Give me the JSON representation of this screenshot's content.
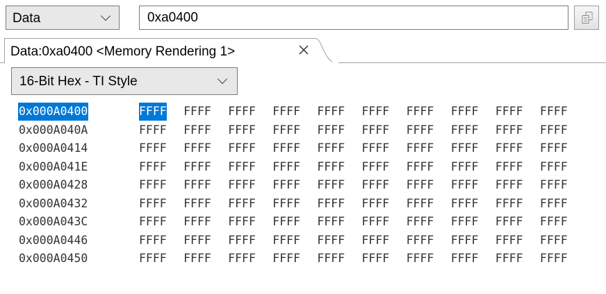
{
  "toolbar": {
    "memory_space": "Data",
    "address": "0xa0400",
    "go_icon": "load-memory-icon"
  },
  "tab": {
    "title": "Data:0xa0400 <Memory Rendering 1>",
    "close_icon": "close-icon"
  },
  "format": {
    "selected": "16-Bit Hex - TI Style"
  },
  "memory": {
    "selected_address_index": 0,
    "selected_word_index": 0,
    "highlight_color": "#0078d7",
    "rows": [
      {
        "address": "0x000A0400",
        "words": [
          "FFFF",
          "FFFF",
          "FFFF",
          "FFFF",
          "FFFF",
          "FFFF",
          "FFFF",
          "FFFF",
          "FFFF",
          "FFFF"
        ]
      },
      {
        "address": "0x000A040A",
        "words": [
          "FFFF",
          "FFFF",
          "FFFF",
          "FFFF",
          "FFFF",
          "FFFF",
          "FFFF",
          "FFFF",
          "FFFF",
          "FFFF"
        ]
      },
      {
        "address": "0x000A0414",
        "words": [
          "FFFF",
          "FFFF",
          "FFFF",
          "FFFF",
          "FFFF",
          "FFFF",
          "FFFF",
          "FFFF",
          "FFFF",
          "FFFF"
        ]
      },
      {
        "address": "0x000A041E",
        "words": [
          "FFFF",
          "FFFF",
          "FFFF",
          "FFFF",
          "FFFF",
          "FFFF",
          "FFFF",
          "FFFF",
          "FFFF",
          "FFFF"
        ]
      },
      {
        "address": "0x000A0428",
        "words": [
          "FFFF",
          "FFFF",
          "FFFF",
          "FFFF",
          "FFFF",
          "FFFF",
          "FFFF",
          "FFFF",
          "FFFF",
          "FFFF"
        ]
      },
      {
        "address": "0x000A0432",
        "words": [
          "FFFF",
          "FFFF",
          "FFFF",
          "FFFF",
          "FFFF",
          "FFFF",
          "FFFF",
          "FFFF",
          "FFFF",
          "FFFF"
        ]
      },
      {
        "address": "0x000A043C",
        "words": [
          "FFFF",
          "FFFF",
          "FFFF",
          "FFFF",
          "FFFF",
          "FFFF",
          "FFFF",
          "FFFF",
          "FFFF",
          "FFFF"
        ]
      },
      {
        "address": "0x000A0446",
        "words": [
          "FFFF",
          "FFFF",
          "FFFF",
          "FFFF",
          "FFFF",
          "FFFF",
          "FFFF",
          "FFFF",
          "FFFF",
          "FFFF"
        ]
      },
      {
        "address": "0x000A0450",
        "words": [
          "FFFF",
          "FFFF",
          "FFFF",
          "FFFF",
          "FFFF",
          "FFFF",
          "FFFF",
          "FFFF",
          "FFFF",
          "FFFF"
        ]
      }
    ]
  }
}
